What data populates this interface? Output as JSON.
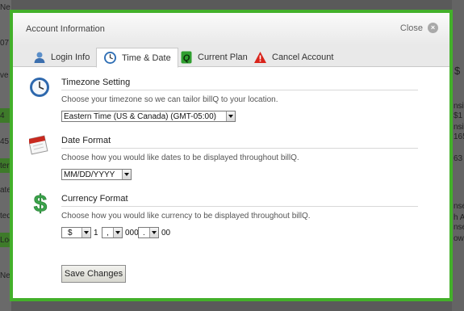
{
  "background": {
    "left_fragments": [
      "Ne",
      "07",
      "ve",
      "4",
      "45",
      "ter",
      "ate",
      "ted",
      "Loc",
      "Ne"
    ],
    "right_fragments": [
      "$",
      "nsiv",
      "$1",
      "nsiv",
      "165",
      "63",
      "nse",
      "h A",
      "nse",
      "ow"
    ]
  },
  "modal": {
    "title": "Account Information",
    "close_label": "Close",
    "close_glyph": "×",
    "border_color": "#43b02a"
  },
  "tabs": [
    {
      "label": "Login Info",
      "icon": "user-icon",
      "active": false
    },
    {
      "label": "Time & Date",
      "icon": "clock-icon",
      "active": true
    },
    {
      "label": "Current Plan",
      "icon": "billq-logo-icon",
      "active": false
    },
    {
      "label": "Cancel Account",
      "icon": "warning-icon",
      "active": false
    }
  ],
  "sections": {
    "timezone": {
      "title": "Timezone Setting",
      "description": "Choose your timezone so we can tailor billQ to your location.",
      "selected": "Eastern Time (US & Canada) (GMT-05:00)",
      "icon": "clock-icon"
    },
    "date_format": {
      "title": "Date Format",
      "description": "Choose how you would like dates to be displayed throughout billQ.",
      "selected": "MM/DD/YYYY",
      "icon": "calendar-icon"
    },
    "currency_format": {
      "title": "Currency Format",
      "description": "Choose how you would like currency to be displayed throughout billQ.",
      "symbol": "$",
      "one": "1",
      "thousands_separator": ",",
      "thousands": "000",
      "decimal_separator": ".",
      "cents": "00",
      "icon": "dollar-icon",
      "icon_color": "#3aa34a"
    }
  },
  "save_button_label": "Save Changes"
}
